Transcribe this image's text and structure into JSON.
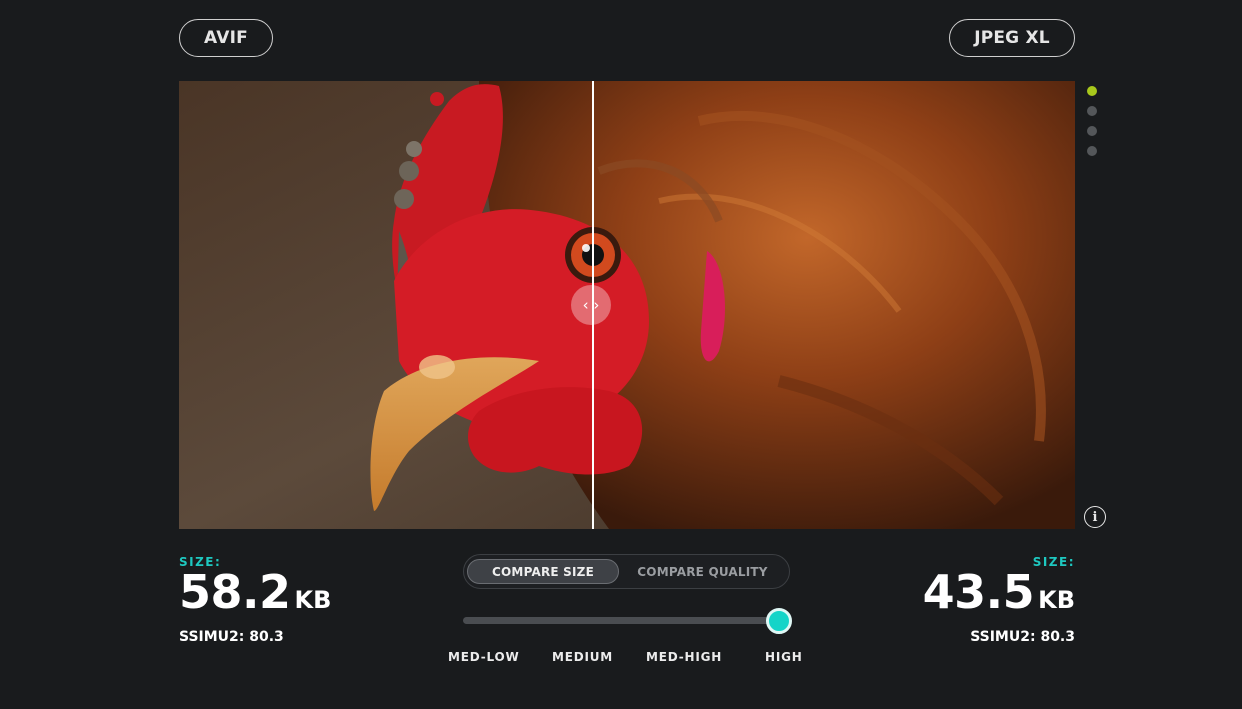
{
  "formats": {
    "left": "AVIF",
    "right": "JPEG XL"
  },
  "compare": {
    "handle_icon": "chevrons-left-right-icon",
    "handle_glyph": "‹ ›",
    "pagination": {
      "count": 4,
      "active_index": 0,
      "active_color": "#a8c81c"
    }
  },
  "info": {
    "icon": "info-icon",
    "glyph": "i"
  },
  "left_stats": {
    "label": "SIZE:",
    "size_value": "58.2",
    "size_unit": "KB",
    "metric": "SSIMU2: 80.3"
  },
  "right_stats": {
    "label": "SIZE:",
    "size_value": "43.5",
    "size_unit": "KB",
    "metric": "SSIMU2: 80.3"
  },
  "mode": {
    "options": [
      "COMPARE SIZE",
      "COMPARE QUALITY"
    ],
    "selected": "COMPARE SIZE"
  },
  "quality": {
    "levels": [
      "MED-LOW",
      "MEDIUM",
      "MED-HIGH",
      "HIGH"
    ],
    "selected": "HIGH",
    "accent_color": "#14d4c8"
  },
  "colors": {
    "background": "#191b1d",
    "label_accent": "#1ec8c0"
  }
}
